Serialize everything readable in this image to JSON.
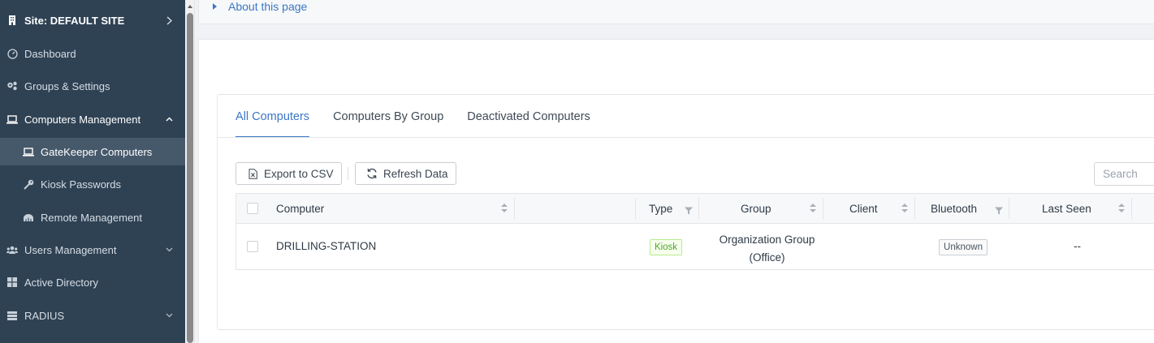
{
  "sidebar": {
    "items": [
      {
        "label": "Site: DEFAULT SITE",
        "icon": "building-icon",
        "chevron": "chevron-right-icon"
      },
      {
        "label": "Dashboard",
        "icon": "dashboard-gauge-icon"
      },
      {
        "label": "Groups & Settings",
        "icon": "gears-icon"
      },
      {
        "label": "Computers Management",
        "icon": "laptop-icon",
        "chevron": "chevron-up-icon"
      },
      {
        "label": "GateKeeper Computers",
        "icon": "laptop-icon",
        "active": true
      },
      {
        "label": "Kiosk Passwords",
        "icon": "key-icon"
      },
      {
        "label": "Remote Management",
        "icon": "remote-icon"
      },
      {
        "label": "Users Management",
        "icon": "users-icon",
        "chevron": "chevron-down-icon"
      },
      {
        "label": "Active Directory",
        "icon": "windows-icon"
      },
      {
        "label": "RADIUS",
        "icon": "server-icon",
        "chevron": "chevron-down-icon"
      }
    ],
    "colors": {
      "background": "#2f4254",
      "active": "#46596b"
    }
  },
  "about": {
    "label": "About this page"
  },
  "tabs": [
    {
      "label": "All Computers",
      "active": true
    },
    {
      "label": "Computers By Group"
    },
    {
      "label": "Deactivated Computers"
    }
  ],
  "toolbar": {
    "export_label": "Export to CSV",
    "refresh_label": "Refresh Data",
    "search_placeholder": "Search"
  },
  "table": {
    "columns": [
      "Computer",
      "Type",
      "Group",
      "Client",
      "Bluetooth",
      "Last Seen"
    ],
    "rows": [
      {
        "computer": "DRILLING-STATION",
        "type": "Kiosk",
        "group_line1": "Organization Group",
        "group_line2": "(Office)",
        "client": "",
        "bluetooth": "Unknown",
        "last_seen": "--"
      }
    ]
  },
  "accent_color": "#3b77c5"
}
